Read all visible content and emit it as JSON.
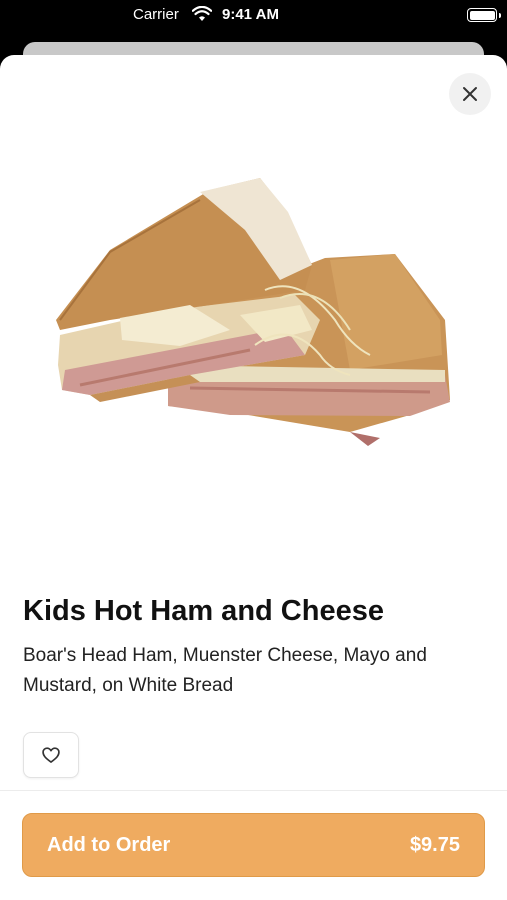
{
  "status_bar": {
    "carrier": "Carrier",
    "time": "9:41 AM"
  },
  "product": {
    "title": "Kids Hot Ham and Cheese",
    "description": "Boar's Head Ham, Muenster Cheese, Mayo and Mustard, on White Bread",
    "image_icon": "sandwich-image"
  },
  "actions": {
    "close_icon": "close-icon",
    "favorite_icon": "heart-icon",
    "add_to_order_label": "Add to Order",
    "price": "$9.75"
  },
  "colors": {
    "accent": "#efab60",
    "text": "#111111"
  }
}
